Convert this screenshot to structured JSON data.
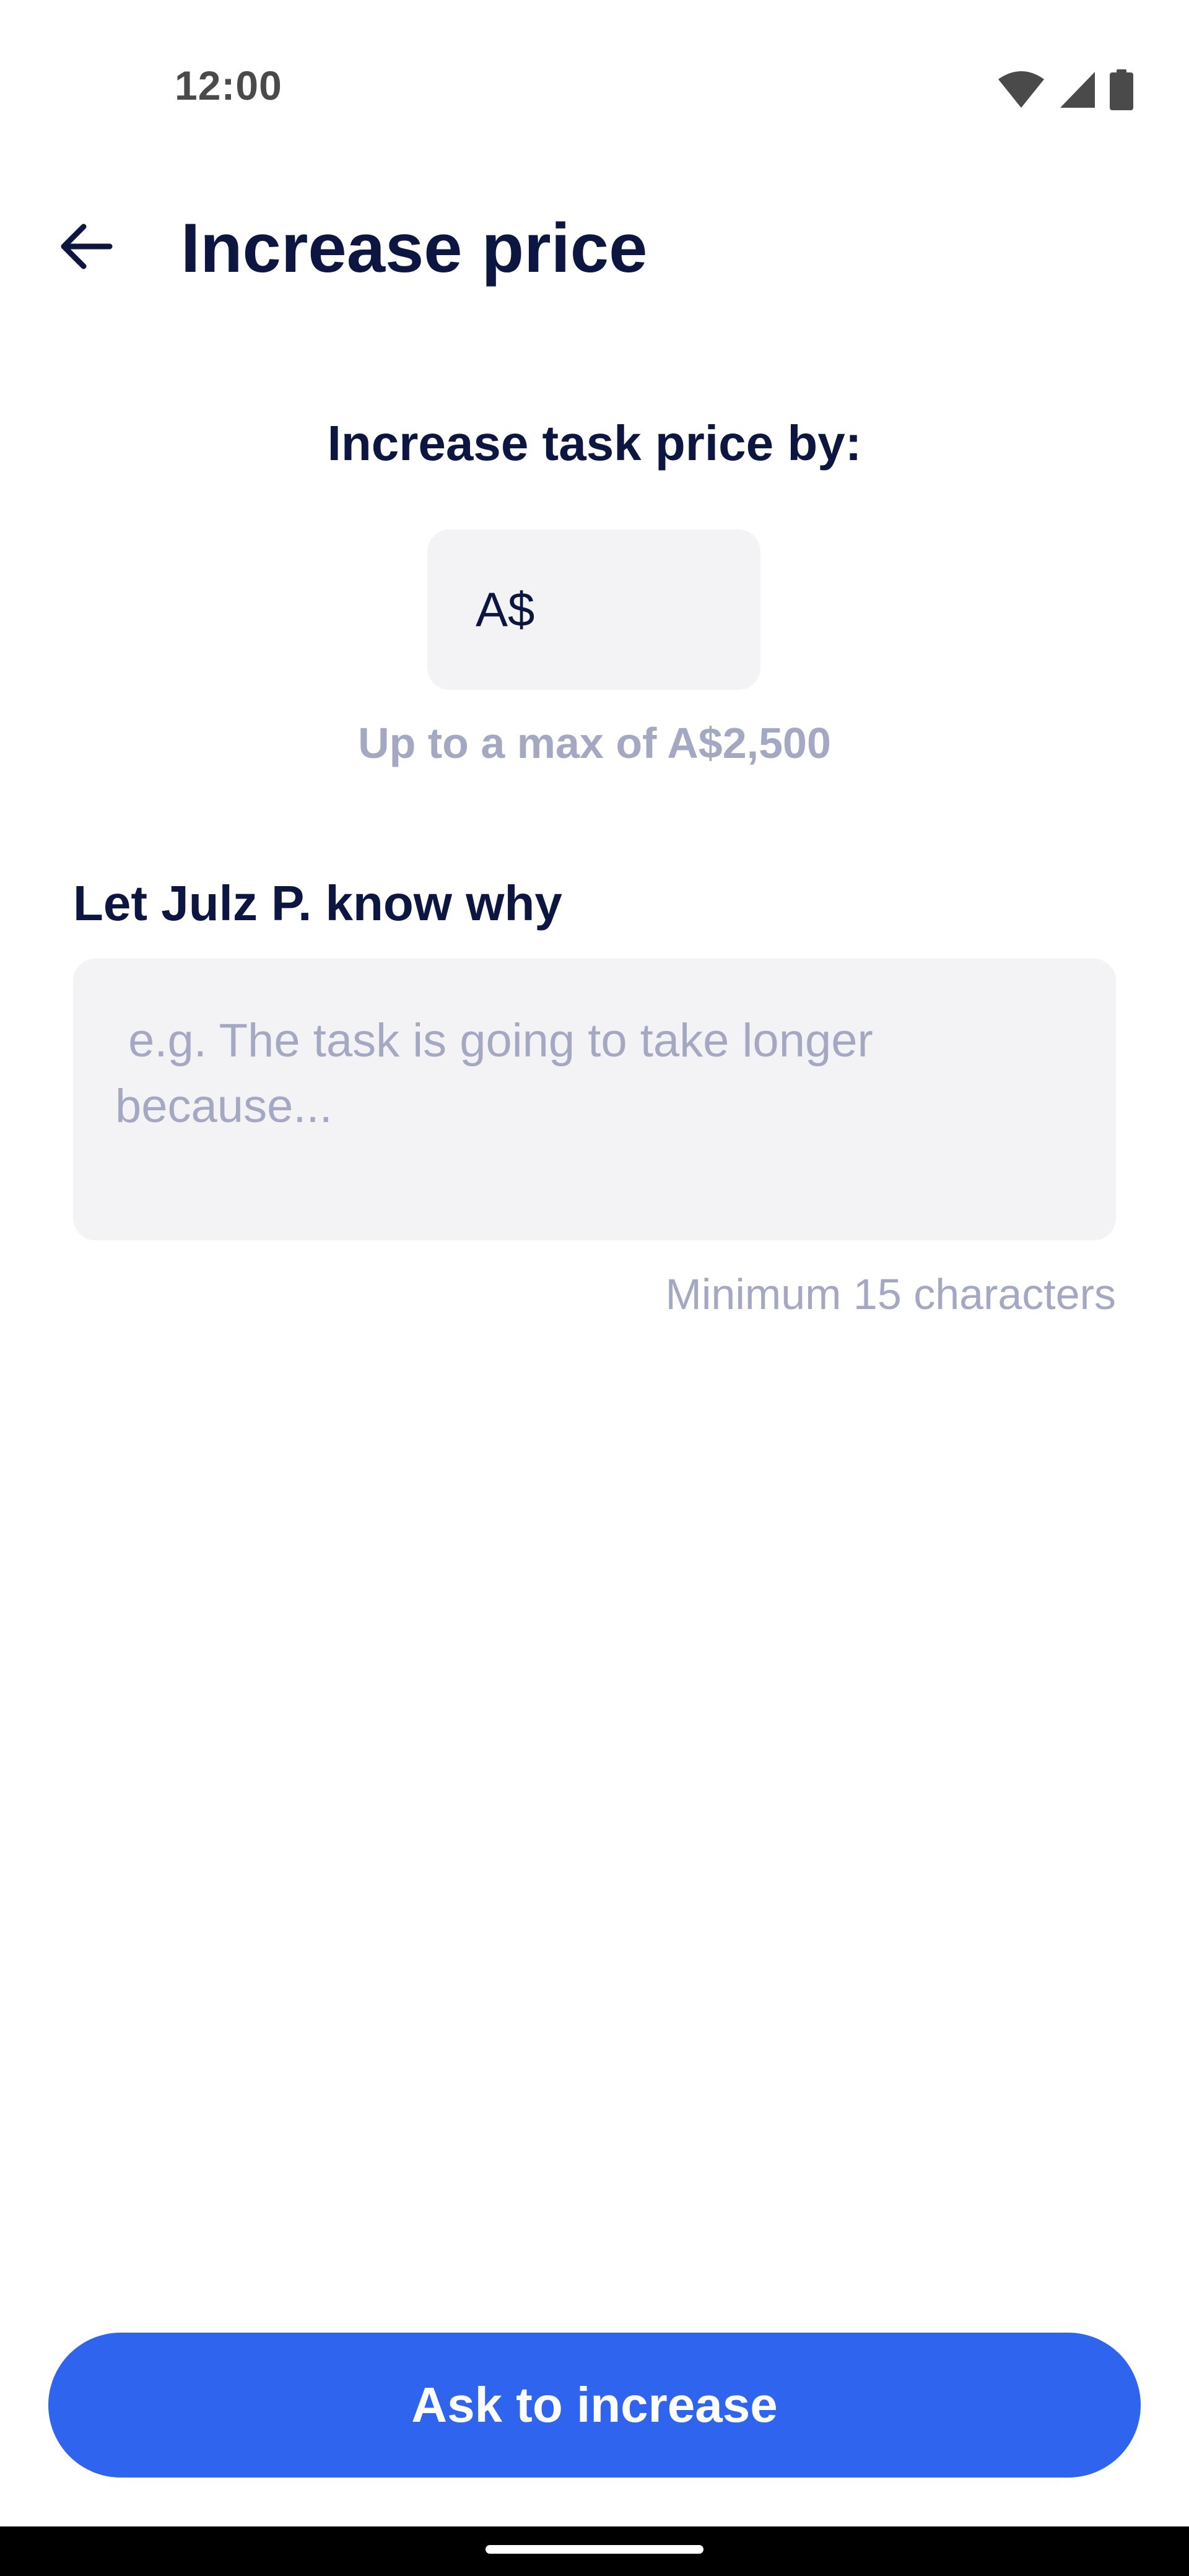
{
  "status_bar": {
    "time": "12:00",
    "icons": [
      "wifi-icon",
      "cellular-signal-icon",
      "battery-icon"
    ]
  },
  "header": {
    "back_icon": "arrow-left-icon",
    "title": "Increase price"
  },
  "price_section": {
    "heading": "Increase task price by:",
    "currency_prefix": "A$",
    "amount_value": "",
    "max_hint": "Up to a max of A$2,500"
  },
  "reason_section": {
    "label": "Let Julz P. know why",
    "value": "",
    "placeholder": " e.g. The task is going to take longer because...",
    "min_hint": "Minimum 15 characters"
  },
  "footer": {
    "submit_label": "Ask to increase"
  },
  "colors": {
    "primary": "#2f64ee",
    "text_dark": "#0d1541",
    "text_muted": "#a4a8c2",
    "input_background": "#f3f3f5"
  }
}
